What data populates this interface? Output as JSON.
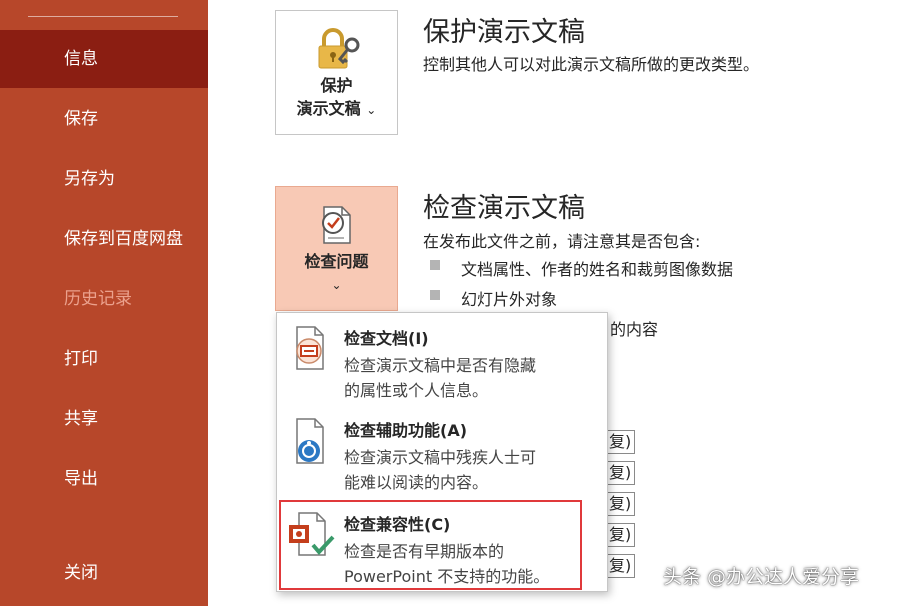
{
  "sidebar": {
    "items": [
      {
        "label": "信息",
        "state": "active"
      },
      {
        "label": "保存",
        "state": "normal"
      },
      {
        "label": "另存为",
        "state": "normal"
      },
      {
        "label": "保存到百度网盘",
        "state": "normal"
      },
      {
        "label": "历史记录",
        "state": "disabled"
      },
      {
        "label": "打印",
        "state": "normal"
      },
      {
        "label": "共享",
        "state": "normal"
      },
      {
        "label": "导出",
        "state": "normal"
      },
      {
        "label": "关闭",
        "state": "normal"
      }
    ]
  },
  "protect": {
    "button_line1": "保护",
    "button_line2": "演示文稿",
    "chevron": "⌄",
    "title": "保护演示文稿",
    "description": "控制其他人可以对此演示文稿所做的更改类型。"
  },
  "inspect": {
    "button_label": "检查问题",
    "chevron": "⌄",
    "title": "检查演示文稿",
    "description": "在发布此文件之前，请注意其是否包含:",
    "bullets": [
      "文档属性、作者的姓名和裁剪图像数据",
      "幻灯片外对象",
      "的内容"
    ]
  },
  "menu": {
    "items": [
      {
        "title": "检查文档(I)",
        "desc_line1": "检查演示文稿中是否有隐藏",
        "desc_line2": "的属性或个人信息。"
      },
      {
        "title": "检查辅助功能(A)",
        "desc_line1": "检查演示文稿中残疾人士可",
        "desc_line2": "能难以阅读的内容。"
      },
      {
        "title": "检查兼容性(C)",
        "desc_line1": "检查是否有早期版本的",
        "desc_line2": "PowerPoint 不支持的功能。"
      }
    ]
  },
  "behind_buttons": [
    "复)",
    "复)",
    "复)",
    "复)",
    "复)"
  ],
  "watermark": "头条 @办公达人爱分享",
  "colors": {
    "sidebar": "#b7472a",
    "sidebar_active": "#8b1e12",
    "tile_highlight": "#f8c9b5",
    "highlight_border": "#e0393b",
    "accent": "#c43e1c"
  }
}
